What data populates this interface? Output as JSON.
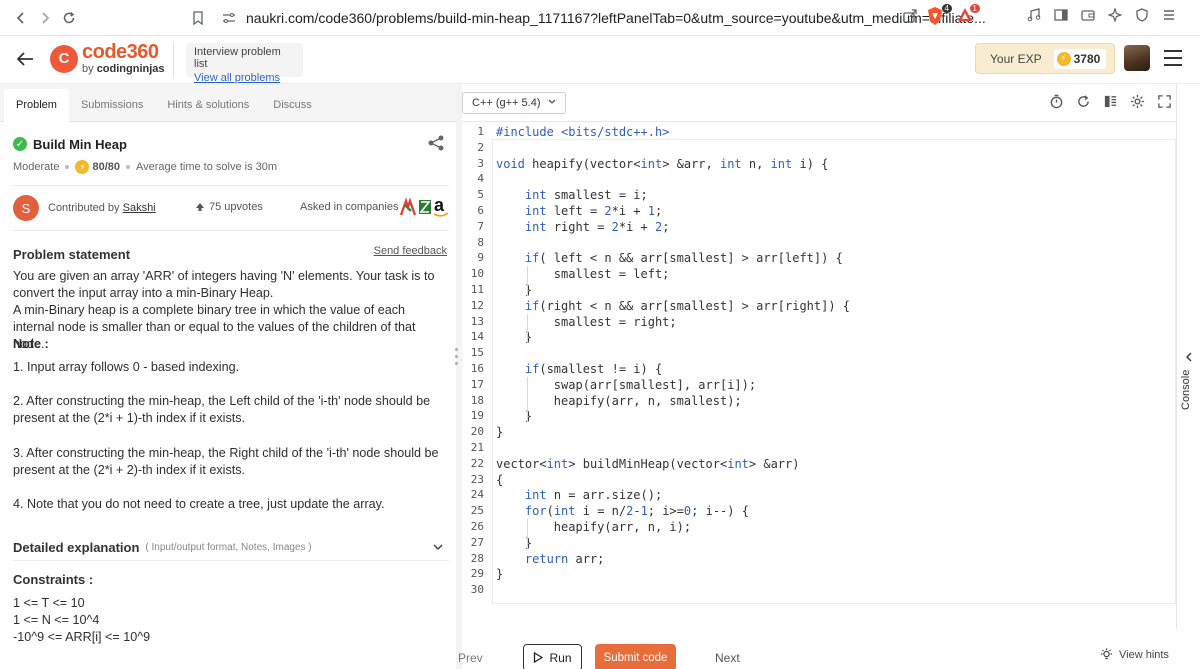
{
  "browser": {
    "url": "naukri.com/code360/problems/build-min-heap_1171167?leftPanelTab=0&utm_source=youtube&utm_medium=affiliate...",
    "badge_count": "4",
    "alert_count": "1"
  },
  "header": {
    "logo_title": "code360",
    "logo_by": "by",
    "logo_brand": "codingninjas",
    "interview_label": "Interview problem list",
    "view_all": "View all problems",
    "exp_label": "Your EXP",
    "exp_value": "3780"
  },
  "left_panel": {
    "tabs": [
      {
        "label": "Problem"
      },
      {
        "label": "Submissions"
      },
      {
        "label": "Hints & solutions"
      },
      {
        "label": "Discuss"
      }
    ],
    "title": "Build Min Heap",
    "difficulty": "Moderate",
    "score": "80/80",
    "avg_time": "Average time to solve is 30m",
    "avatar_letter": "S",
    "contributed_label": "Contributed by",
    "contributor": "Sakshi",
    "upvotes": "75 upvotes",
    "asked_label": "Asked in companies",
    "problem_statement_heading": "Problem statement",
    "send_feedback": "Send feedback",
    "p1": "You are given an array 'ARR' of integers having 'N' elements. Your task is to convert the input array into a min-Binary Heap.",
    "p2": "A min-Binary heap is a complete binary tree in which the value of each internal node is smaller than or equal to the values of the children of that node.",
    "note_label": "Note :",
    "n1": "1. Input array follows 0 - based indexing.",
    "n2": "2. After constructing the min-heap, the Left child of the 'i-th' node should be present at the (2*i + 1)-th index if it exists.",
    "n3": "3. After constructing the min-heap, the Right child of the 'i-th' node should be present at the (2*i + 2)-th index if it exists.",
    "n4": "4. Note that you do not need to create a tree, just update the array.",
    "detailed_heading": "Detailed explanation",
    "detailed_sub": "( Input/output format, Notes, Images )",
    "constraints_heading": "Constraints :",
    "c1": "1 <= T <= 10",
    "c2": "1 <= N <= 10^4",
    "c3": "-10^9 <= ARR[i] <= 10^9"
  },
  "editor": {
    "language": "C++ (g++ 5.4)",
    "lines": [
      "#include <bits/stdc++.h>",
      "",
      "void heapify(vector<int> &arr, int n, int i) {",
      "",
      "    int smallest = i;",
      "    int left = 2*i + 1;",
      "    int right = 2*i + 2;",
      "",
      "    if( left < n && arr[smallest] > arr[left]) {",
      "        smallest = left;",
      "    }",
      "    if(right < n && arr[smallest] > arr[right]) {",
      "        smallest = right;",
      "    }",
      "",
      "    if(smallest != i) {",
      "        swap(arr[smallest], arr[i]);",
      "        heapify(arr, n, smallest);",
      "    }",
      "}",
      "",
      "vector<int> buildMinHeap(vector<int> &arr)",
      "{",
      "    int n = arr.size();",
      "    for(int i = n/2-1; i>=0; i--) {",
      "        heapify(arr, n, i);",
      "    }",
      "    return arr;",
      "}",
      ""
    ],
    "prev": "Prev",
    "run": "Run",
    "submit": "Submit code",
    "next": "Next"
  },
  "console": {
    "label": "Console",
    "view_hints": "View hints"
  },
  "colors": {
    "brand": "#e8582c",
    "submit": "#e96d3b",
    "keyword": "#2e5fb8",
    "success": "#3fb950"
  }
}
